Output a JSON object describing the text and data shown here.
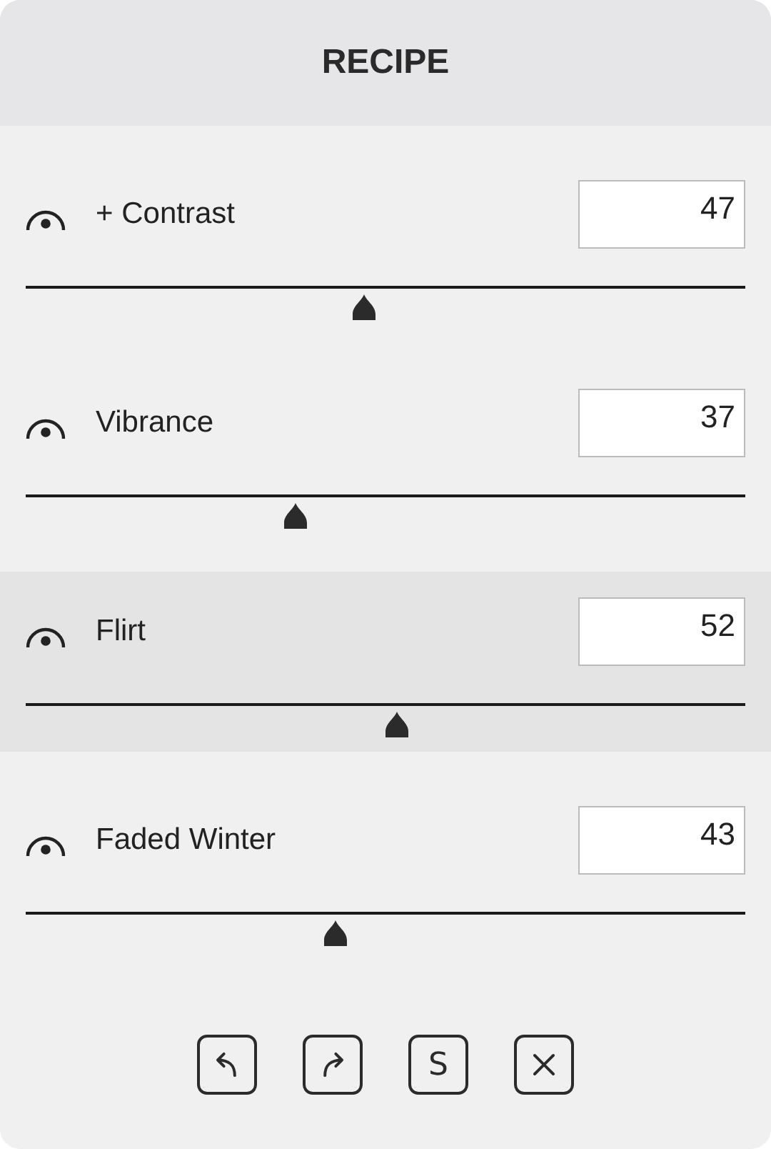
{
  "title": "RECIPE",
  "sliders": [
    {
      "label": "+ Contrast",
      "value": "47",
      "level": 0.47,
      "selected": false
    },
    {
      "label": "Vibrance",
      "value": "37",
      "level": 0.375,
      "selected": false
    },
    {
      "label": "Flirt",
      "value": "52",
      "level": 0.515,
      "selected": true
    },
    {
      "label": "Faded Winter",
      "value": "43",
      "level": 0.43,
      "selected": false
    }
  ],
  "buttons": [
    {
      "kind": "undo"
    },
    {
      "kind": "redo"
    },
    {
      "kind": "text",
      "label": "S"
    },
    {
      "kind": "close"
    }
  ]
}
